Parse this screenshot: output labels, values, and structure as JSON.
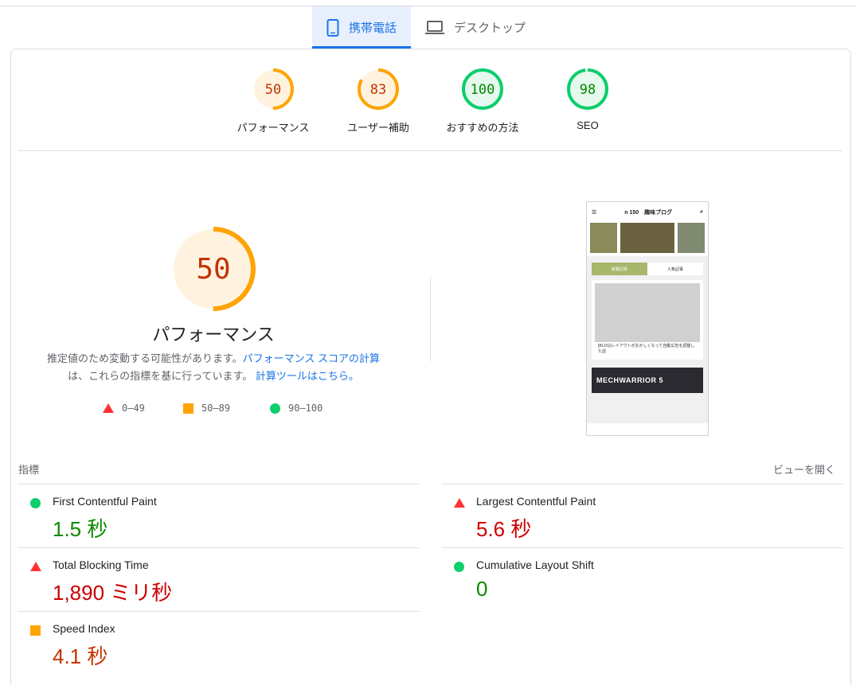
{
  "tabs": [
    {
      "label": "携帯電話",
      "active": true,
      "icon": "smartphone-icon"
    },
    {
      "label": "デスクトップ",
      "active": false,
      "icon": "laptop-icon"
    }
  ],
  "categories": [
    {
      "score": "50",
      "label": "パフォーマンス",
      "fraction": 0.5,
      "color": "#ffa400",
      "bg": "#fff3e0",
      "text": "#c33300"
    },
    {
      "score": "83",
      "label": "ユーザー補助",
      "fraction": 0.83,
      "color": "#ffa400",
      "bg": "#fff3e0",
      "text": "#c33300"
    },
    {
      "score": "100",
      "label": "おすすめの方法",
      "fraction": 1.0,
      "color": "#0cce6b",
      "bg": "#e6f9ee",
      "text": "#008800"
    },
    {
      "score": "98",
      "label": "SEO",
      "fraction": 0.98,
      "color": "#0cce6b",
      "bg": "#e6f9ee",
      "text": "#008800"
    }
  ],
  "main_score": {
    "score": "50",
    "title": "パフォーマンス",
    "fraction": 0.5
  },
  "description": {
    "part1": "推定値のため変動する可能性があります。",
    "link1": "パフォーマンス スコアの計算",
    "part2": "は、これらの指標を基に行っています。",
    "link2": "計算ツールはこちら。"
  },
  "legend": [
    {
      "range": "0–49",
      "shape": "triangle",
      "color": "#ff3333"
    },
    {
      "range": "50–89",
      "shape": "square",
      "color": "#ffa400"
    },
    {
      "range": "90–100",
      "shape": "circle",
      "color": "#0cce6b"
    }
  ],
  "preview": {
    "site_title": "n 150　趣味ブログ",
    "caption1": "[BLOG]レイアウトがおかしくなって自動広告を調整した話",
    "tab_new": "新着記事",
    "tab_popular": "人気記事",
    "banner": "MECHWARRIOR 5"
  },
  "metrics_header": "指標",
  "view_link": "ビューを開く",
  "metrics": [
    {
      "name": "First Contentful Paint",
      "value": "1.5 秒",
      "status": "good"
    },
    {
      "name": "Largest Contentful Paint",
      "value": "5.6 秒",
      "status": "poor"
    },
    {
      "name": "Total Blocking Time",
      "value": "1,890 ミリ秒",
      "status": "poor"
    },
    {
      "name": "Cumulative Layout Shift",
      "value": "0",
      "status": "good"
    },
    {
      "name": "Speed Index",
      "value": "4.1 秒",
      "status": "average"
    }
  ]
}
